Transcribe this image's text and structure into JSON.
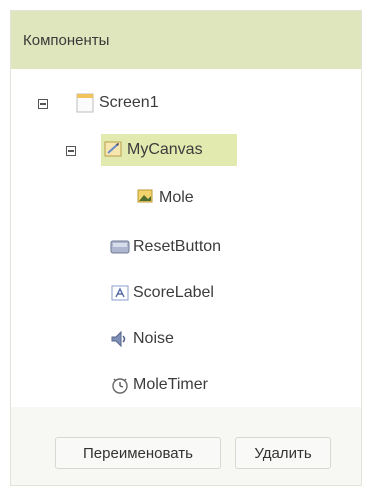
{
  "panel": {
    "title": "Компоненты"
  },
  "tree": {
    "screen": "Screen1",
    "canvas": "MyCanvas",
    "mole": "Mole",
    "reset": "ResetButton",
    "score": "ScoreLabel",
    "noise": "Noise",
    "timer": "MoleTimer"
  },
  "buttons": {
    "rename": "Переименовать",
    "delete": "Удалить"
  },
  "colors": {
    "header_bg": "#dfe6bd",
    "selected_bg": "#e3eaaf"
  }
}
